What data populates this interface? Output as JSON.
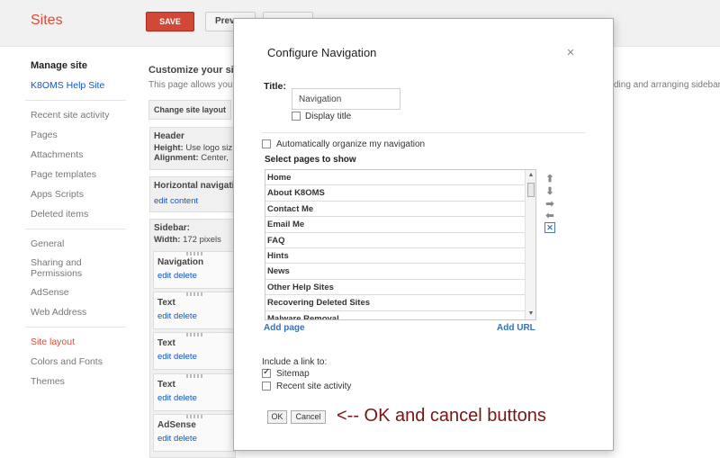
{
  "app": {
    "title": "Sites",
    "save_label": "SAVE",
    "preview_label": "Prev"
  },
  "sidebar": {
    "manage_heading": "Manage site",
    "site_name": "K8OMS Help Site",
    "group1": [
      "Recent site activity",
      "Pages",
      "Attachments",
      "Page templates",
      "Apps Scripts",
      "Deleted items"
    ],
    "group2": [
      "General",
      "Sharing and Permissions",
      "AdSense",
      "Web Address"
    ],
    "group3": [
      "Site layout",
      "Colors and Fonts",
      "Themes"
    ]
  },
  "main": {
    "customize_title": "Customize your site",
    "customize_desc": "This page allows you",
    "right_desc": "ding and arranging sidebar ite",
    "change_layout_label": "Change site layout",
    "header_block": {
      "title": "Header",
      "height_label": "Height:",
      "height_value": "Use logo siz",
      "align_label": "Alignment:",
      "align_value": "Center,"
    },
    "horizontal_nav": {
      "title": "Horizontal navigati",
      "link": "edit content"
    },
    "sidebar_block": {
      "title": "Sidebar:",
      "width_label": "Width:",
      "width_value": "172 pixels"
    },
    "gadgets": [
      {
        "title": "Navigation",
        "edit": "edit",
        "delete": "delete"
      },
      {
        "title": "Text",
        "edit": "edit",
        "delete": "delete"
      },
      {
        "title": "Text",
        "edit": "edit",
        "delete": "delete"
      },
      {
        "title": "Text",
        "edit": "edit",
        "delete": "delete"
      },
      {
        "title": "AdSense",
        "edit": "edit",
        "delete": "delete"
      }
    ]
  },
  "dialog": {
    "title": "Configure Navigation",
    "close_icon": "close-icon",
    "title_label": "Title:",
    "title_value": "Navigation",
    "display_title_label": "Display title",
    "display_title_checked": false,
    "auto_organize_label": "Automatically organize my navigation",
    "auto_organize_checked": false,
    "select_pages_label": "Select pages to show",
    "pages": [
      "Home",
      "About K8OMS",
      "Contact Me",
      "Email Me",
      "FAQ",
      "Hints",
      "News",
      "Other Help Sites",
      "Recovering Deleted Sites",
      "Malware Removal"
    ],
    "controls": [
      "move-up-icon",
      "move-down-icon",
      "move-right-icon",
      "move-left-icon",
      "remove-icon"
    ],
    "add_page_label": "Add page",
    "add_url_label": "Add URL",
    "include_label": "Include a link to:",
    "sitemap_label": "Sitemap",
    "sitemap_checked": true,
    "recent_activity_label": "Recent site activity",
    "recent_activity_checked": false,
    "ok_label": "OK",
    "cancel_label": "Cancel",
    "annotation": "<-- OK and cancel buttons"
  }
}
